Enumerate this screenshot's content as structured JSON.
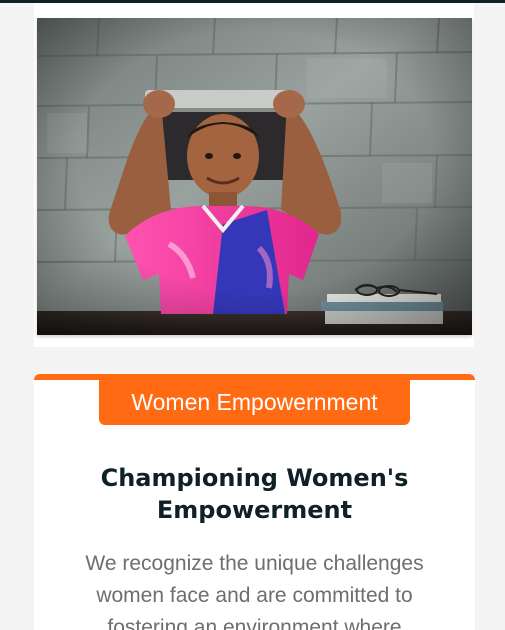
{
  "photo": {
    "alt": "Smiling child holding a laptop on top of his head",
    "colors": {
      "wall": "#8a9290",
      "shirt_pink": "#ff3fa6",
      "shirt_blue": "#3437b8",
      "table": "#2e2622"
    }
  },
  "card": {
    "badge_label": "Women Empowernment",
    "title_line1": "Championing Women's",
    "title_line2": "Empowerment",
    "body_text": "We recognize the unique challenges women face and are committed to fostering an environment where"
  },
  "colors": {
    "accent": "#ff6a13",
    "title": "#0f2027",
    "body": "#6e6e6e",
    "page_background": "#f4f4f4"
  }
}
